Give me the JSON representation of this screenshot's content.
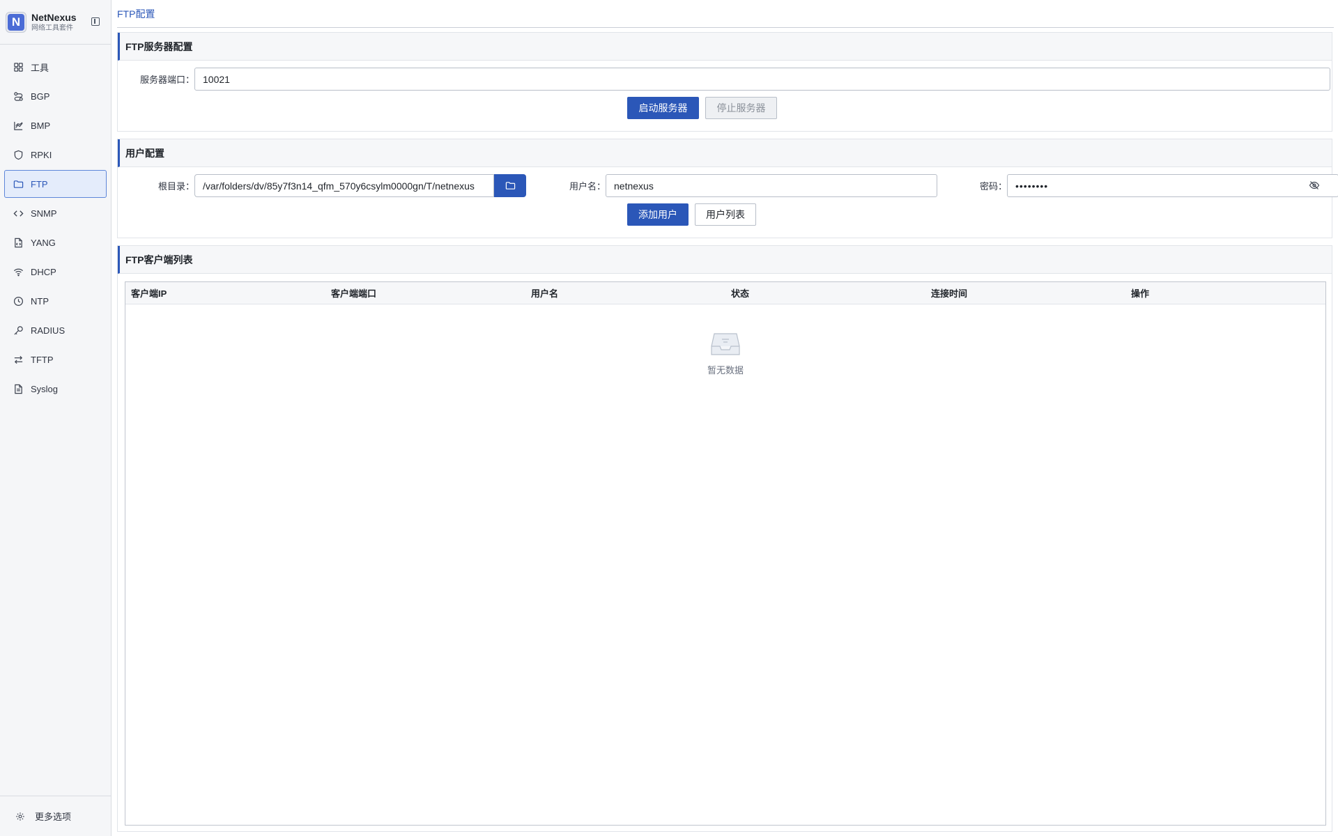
{
  "brand": {
    "title": "NetNexus",
    "subtitle": "网络工具套件",
    "logo_letter": "N"
  },
  "sidebar": {
    "items": [
      {
        "label": "工具",
        "icon": "grid-icon"
      },
      {
        "label": "BGP",
        "icon": "route-icon"
      },
      {
        "label": "BMP",
        "icon": "chart-icon"
      },
      {
        "label": "RPKI",
        "icon": "shield-icon"
      },
      {
        "label": "FTP",
        "icon": "folder-icon",
        "active": true
      },
      {
        "label": "SNMP",
        "icon": "code-icon"
      },
      {
        "label": "YANG",
        "icon": "file-code-icon"
      },
      {
        "label": "DHCP",
        "icon": "wifi-icon"
      },
      {
        "label": "NTP",
        "icon": "clock-icon"
      },
      {
        "label": "RADIUS",
        "icon": "key-icon"
      },
      {
        "label": "TFTP",
        "icon": "swap-icon"
      },
      {
        "label": "Syslog",
        "icon": "file-text-icon"
      }
    ],
    "footer_label": "更多选项"
  },
  "tabs": [
    {
      "label": "FTP配置",
      "active": true
    }
  ],
  "server_config": {
    "title": "FTP服务器配置",
    "port_label": "服务器端口：",
    "port_value": "10021",
    "start_label": "启动服务器",
    "stop_label": "停止服务器"
  },
  "user_config": {
    "title": "用户配置",
    "root_label": "根目录：",
    "root_value": "/var/folders/dv/85y7f3n14_qfm_570y6csylm0000gn/T/netnexus",
    "username_label": "用户名：",
    "username_value": "netnexus",
    "password_label": "密码：",
    "password_value": "••••••••",
    "add_label": "添加用户",
    "list_label": "用户列表"
  },
  "client_list": {
    "title": "FTP客户端列表",
    "columns": [
      "客户端IP",
      "客户端端口",
      "用户名",
      "状态",
      "连接时间",
      "操作"
    ],
    "rows": [],
    "empty_text": "暂无数据"
  },
  "colors": {
    "primary": "#2b57b8",
    "sidebar_bg": "#f5f6f8",
    "active_bg": "#e4ecfb"
  }
}
